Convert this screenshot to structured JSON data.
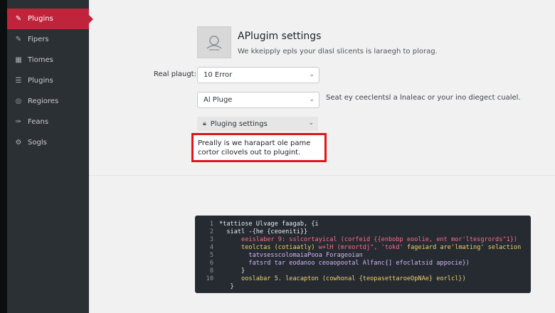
{
  "sidebar": {
    "items": [
      {
        "icon": "plug-icon",
        "label": "Plugins",
        "active": true
      },
      {
        "icon": "pen-icon",
        "label": "Fipers",
        "active": false
      },
      {
        "icon": "themes-icon",
        "label": "Tiomes",
        "active": false
      },
      {
        "icon": "list-icon",
        "label": "Plugins",
        "active": false
      },
      {
        "icon": "circle-icon",
        "label": "Regiores",
        "active": false
      },
      {
        "icon": "wrench-icon",
        "label": "Feans",
        "active": false
      },
      {
        "icon": "settings-icon",
        "label": "Sogls",
        "active": false
      }
    ],
    "accent": "#c0243b"
  },
  "plugin": {
    "title": "APlugim settings",
    "description": "We kkeipply epls your dlasl slicents is laraegh to plorag."
  },
  "form": {
    "row_label": "Real plaugt:",
    "select1_value": "10 Error",
    "select2_value": "Al Pluge",
    "side_note": "Seat ey ceeclentsl a lnaleac or your ino diegect cualel.",
    "settings_button": "Pluging settings"
  },
  "notice": {
    "line1": "Preally is we harapart ole pame",
    "line2": "cortor cilovels out to plugint.",
    "border_color": "#e0161d"
  },
  "code": {
    "lines": [
      {
        "n": "1",
        "segments": [
          {
            "c": "w",
            "t": "*tattiose Ulvage faagab, {i"
          }
        ]
      },
      {
        "n": "2",
        "segments": [
          {
            "c": "w",
            "t": "  siatl -{he {ceoeniti}}"
          }
        ]
      },
      {
        "n": "3",
        "segments": [
          {
            "c": "k",
            "t": "      eeislaber 9: sslcortayical (corfeid {{enbobp eoolie, ent mor'ltesgrords\"1})"
          }
        ]
      },
      {
        "n": "4",
        "segments": [
          {
            "c": "y",
            "t": "      "
          },
          {
            "c": "y",
            "t": "teolctas (cotiaatly) "
          },
          {
            "c": "k",
            "t": "w+lH (mreortdj\", 'tokd' "
          },
          {
            "c": "y",
            "t": "fageiard are'lmating' selaction"
          }
        ]
      },
      {
        "n": "5",
        "segments": [
          {
            "c": "p",
            "t": "        tatvsesscolomaiaPooa Forageoian"
          }
        ]
      },
      {
        "n": "6",
        "segments": [
          {
            "c": "p",
            "t": "        fatsrd tar eodanoo ceoaopootal Alfanc{] efoclatsid appocie})"
          }
        ]
      },
      {
        "n": "8",
        "segments": [
          {
            "c": "w",
            "t": "      }"
          }
        ]
      },
      {
        "n": "10",
        "segments": [
          {
            "c": "y",
            "t": "      ooslabar 5. leacapton (cowhonal {teopasettaroeOpNAe} eorlcl})"
          }
        ]
      },
      {
        "n": "",
        "segments": [
          {
            "c": "w",
            "t": "   }"
          }
        ]
      }
    ]
  }
}
